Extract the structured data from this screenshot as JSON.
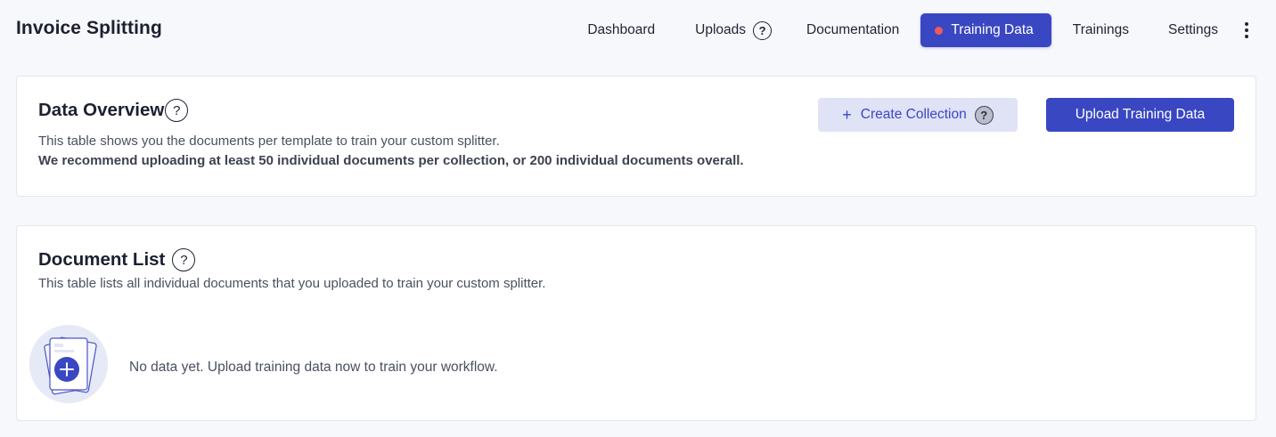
{
  "app": {
    "title": "Invoice Splitting"
  },
  "nav": {
    "items": [
      {
        "label": "Dashboard"
      },
      {
        "label": "Uploads",
        "help": "?"
      },
      {
        "label": "Documentation"
      },
      {
        "label": "Training Data",
        "active": true
      },
      {
        "label": "Trainings"
      },
      {
        "label": "Settings"
      }
    ]
  },
  "overview": {
    "title": "Data Overview",
    "help": "?",
    "description": "This table shows you the documents per template to train your custom splitter.",
    "recommendation": "We recommend uploading at least 50 individual documents per collection, or 200 individual documents overall.",
    "create_collection_label": "Create Collection",
    "create_collection_icon": "+",
    "create_collection_help": "?",
    "upload_label": "Upload Training Data"
  },
  "document_list": {
    "title": "Document List",
    "help": "?",
    "description": "This table lists all individual documents that you uploaded to train your custom splitter.",
    "empty_message": "No data yet. Upload training data now to train your workflow."
  },
  "colors": {
    "accent": "#3a47c2",
    "accent_light": "#e0e2f6",
    "status_dot": "#f05a5a",
    "background": "#f7f8fc"
  }
}
